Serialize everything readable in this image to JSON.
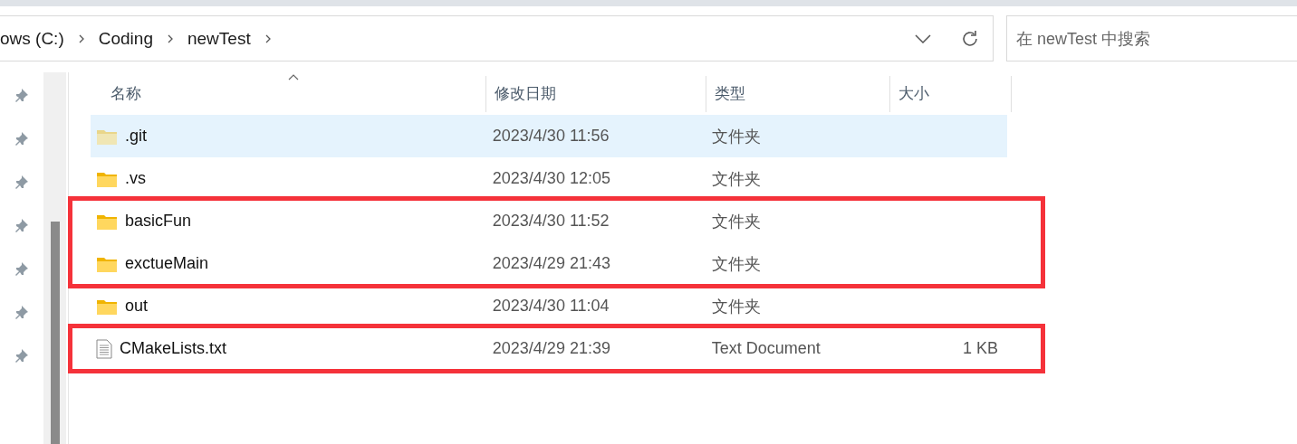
{
  "address_bar": {
    "path": [
      {
        "label": "ows (C:)"
      },
      {
        "label": "Coding"
      },
      {
        "label": "newTest"
      }
    ]
  },
  "search": {
    "placeholder": "在 newTest 中搜索"
  },
  "columns": [
    {
      "label": "名称",
      "sorted": true
    },
    {
      "label": "修改日期",
      "sorted": false
    },
    {
      "label": "类型",
      "sorted": false
    },
    {
      "label": "大小",
      "sorted": false
    }
  ],
  "groups": [
    {
      "boxed": false,
      "rows": [
        {
          "kind": "folder",
          "name": ".git",
          "modified": "2023/4/30 11:56",
          "type": "文件夹",
          "selected": true,
          "hidden": true
        },
        {
          "kind": "folder",
          "name": ".vs",
          "modified": "2023/4/30 12:05",
          "type": "文件夹",
          "selected": false,
          "hidden": false
        }
      ]
    },
    {
      "boxed": true,
      "rows": [
        {
          "kind": "folder",
          "name": "basicFun",
          "modified": "2023/4/30 11:52",
          "type": "文件夹",
          "selected": false,
          "hidden": false
        },
        {
          "kind": "folder",
          "name": "exctueMain",
          "modified": "2023/4/29 21:43",
          "type": "文件夹",
          "selected": false,
          "hidden": false
        }
      ]
    },
    {
      "boxed": false,
      "rows": [
        {
          "kind": "folder",
          "name": "out",
          "modified": "2023/4/30 11:04",
          "type": "文件夹",
          "selected": false,
          "hidden": false
        }
      ]
    },
    {
      "boxed": true,
      "rows": [
        {
          "kind": "file",
          "name": "CMakeLists.txt",
          "modified": "2023/4/29 21:39",
          "type": "Text Document",
          "size": "1 KB",
          "selected": false,
          "hidden": false
        }
      ]
    }
  ]
}
